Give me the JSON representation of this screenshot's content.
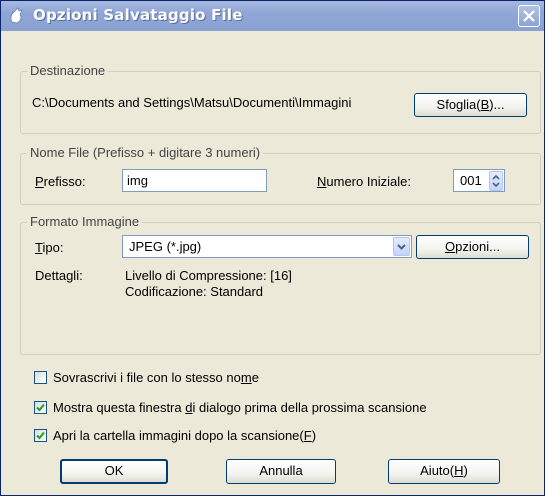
{
  "window": {
    "title": "Opzioni Salvataggio File",
    "title_icon": "scanner-icon",
    "close_icon": "close-icon"
  },
  "destinazione": {
    "group_label": "Destinazione",
    "path": "C:\\Documents and Settings\\Matsu\\Documenti\\Immagini",
    "browse_label": "Sfoglia(B)..."
  },
  "nome_file": {
    "group_label": "Nome File (Prefisso + digitare 3 numeri)",
    "prefix_label": "Prefisso:",
    "prefix_value": "img",
    "start_number_label": "Numero Iniziale:",
    "start_number_value": "001"
  },
  "formato": {
    "group_label": "Formato Immagine",
    "type_label": "Tipo:",
    "type_value": "JPEG (*.jpg)",
    "options_label": "Opzioni...",
    "details_label": "Dettagli:",
    "details_line1": "Livello di Compressione: [16]",
    "details_line2": "Codificazione: Standard"
  },
  "checkboxes": [
    {
      "label": "Sovrascrivi i file con lo stesso nome",
      "checked": false
    },
    {
      "label": "Mostra questa finestra di dialogo prima della prossima scansione",
      "checked": true
    },
    {
      "label": "Apri la cartella immagini dopo la scansione(F)",
      "checked": true
    }
  ],
  "buttons": {
    "ok": "OK",
    "cancel": "Annulla",
    "help": "Aiuto(H)"
  }
}
